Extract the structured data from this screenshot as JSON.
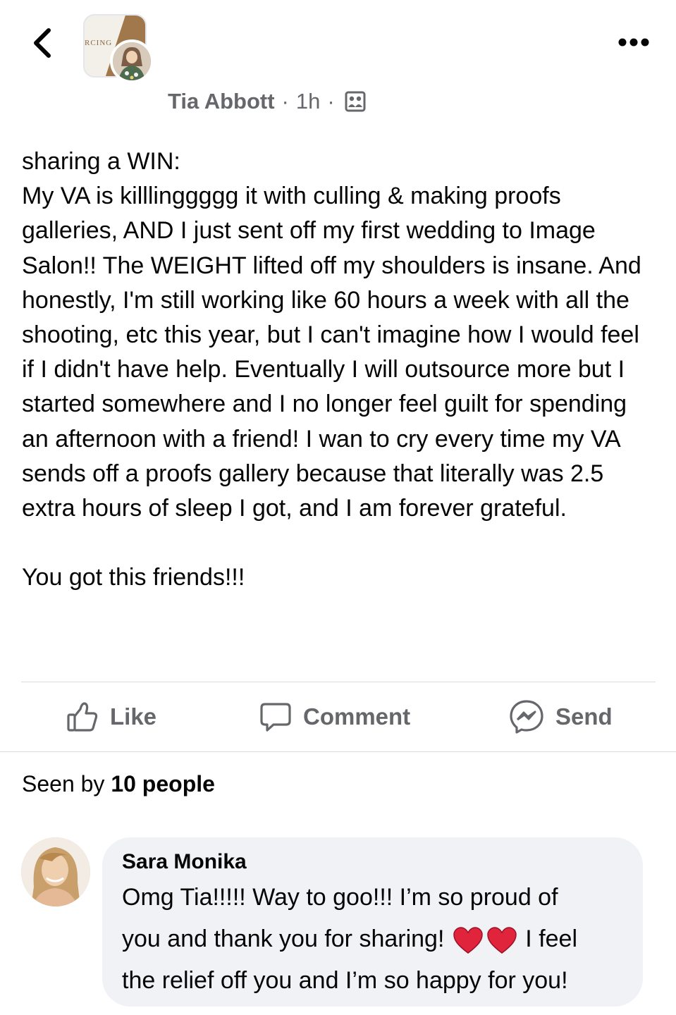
{
  "header": {
    "group_logo_text": "RCING",
    "author": "Tia Abbott",
    "time": "1h",
    "separator": "·",
    "privacy_icon": "group-members-icon",
    "back_icon": "chevron-left-icon",
    "more_icon": "more-dots-icon"
  },
  "post": {
    "body": "sharing a WIN:\nMy VA is killlinggggg it with culling & making proofs galleries, AND I just sent off my first wedding to Image Salon!! The WEIGHT lifted off my shoulders is insane. And honestly, I'm still working like 60 hours a week with all the shooting, etc this year, but I can't imagine how I would feel if I didn't have help. Eventually I will outsource more but I started somewhere and I no longer feel guilt for spending an afternoon with a friend! I wan to cry every time my VA sends off a proofs gallery because that literally was 2.5 extra hours of sleep I got, and I am forever grateful.\n\nYou got this friends!!!"
  },
  "actions": {
    "like": "Like",
    "comment": "Comment",
    "send": "Send"
  },
  "seen": {
    "prefix": "Seen by ",
    "count": "10 people"
  },
  "comment": {
    "name": "Sara Monika",
    "text_line1": "Omg Tia!!!!! Way to goo!!! I’m so proud of",
    "text_line2a": "you and thank you for sharing! ",
    "text_line2b": " I feel",
    "text_line3": "the relief off you and I’m so happy for you!"
  },
  "colors": {
    "secondary_text": "#65676b",
    "bubble_bg": "#f0f2f5",
    "heart": "#e0243b"
  }
}
